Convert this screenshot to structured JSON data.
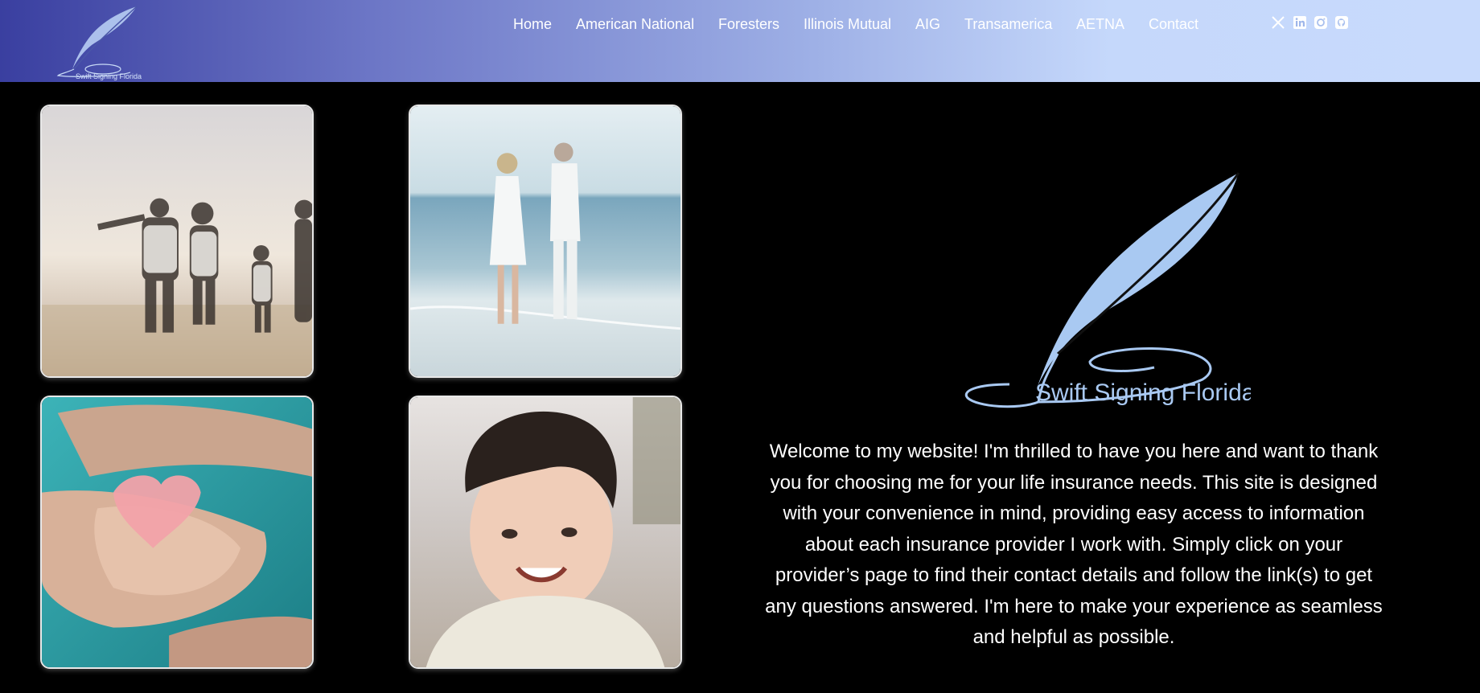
{
  "brand": {
    "name": "Swift Signing Florida"
  },
  "nav": {
    "items": [
      {
        "label": "Home"
      },
      {
        "label": "American National"
      },
      {
        "label": "Foresters"
      },
      {
        "label": "Illinois Mutual"
      },
      {
        "label": "AIG"
      },
      {
        "label": "Transamerica"
      },
      {
        "label": "AETNA"
      },
      {
        "label": "Contact"
      }
    ]
  },
  "social": [
    {
      "icon": "x-twitter-icon"
    },
    {
      "icon": "linkedin-icon"
    },
    {
      "icon": "instagram-icon"
    },
    {
      "icon": "github-icon"
    }
  ],
  "gallery": [
    {
      "icon": "family-beach-sunset-photo"
    },
    {
      "icon": "couple-beach-walk-photo"
    },
    {
      "icon": "hands-holding-heart-photo"
    },
    {
      "icon": "smiling-child-photo"
    }
  ],
  "main": {
    "welcome_text": "Welcome to my website! I'm thrilled to have you here and want to thank you for choosing me for your life insurance needs. This site is designed with your convenience in mind, providing easy access to information about each insurance provider I work with. Simply click on your provider’s page to find their contact details and follow the link(s) to get any questions answered. I'm here to make your experience as seamless and helpful as possible."
  },
  "colors": {
    "header_start": "#3a3fa0",
    "header_end": "#c8dafc",
    "feather": "#a9c9f2",
    "background": "#000000"
  }
}
